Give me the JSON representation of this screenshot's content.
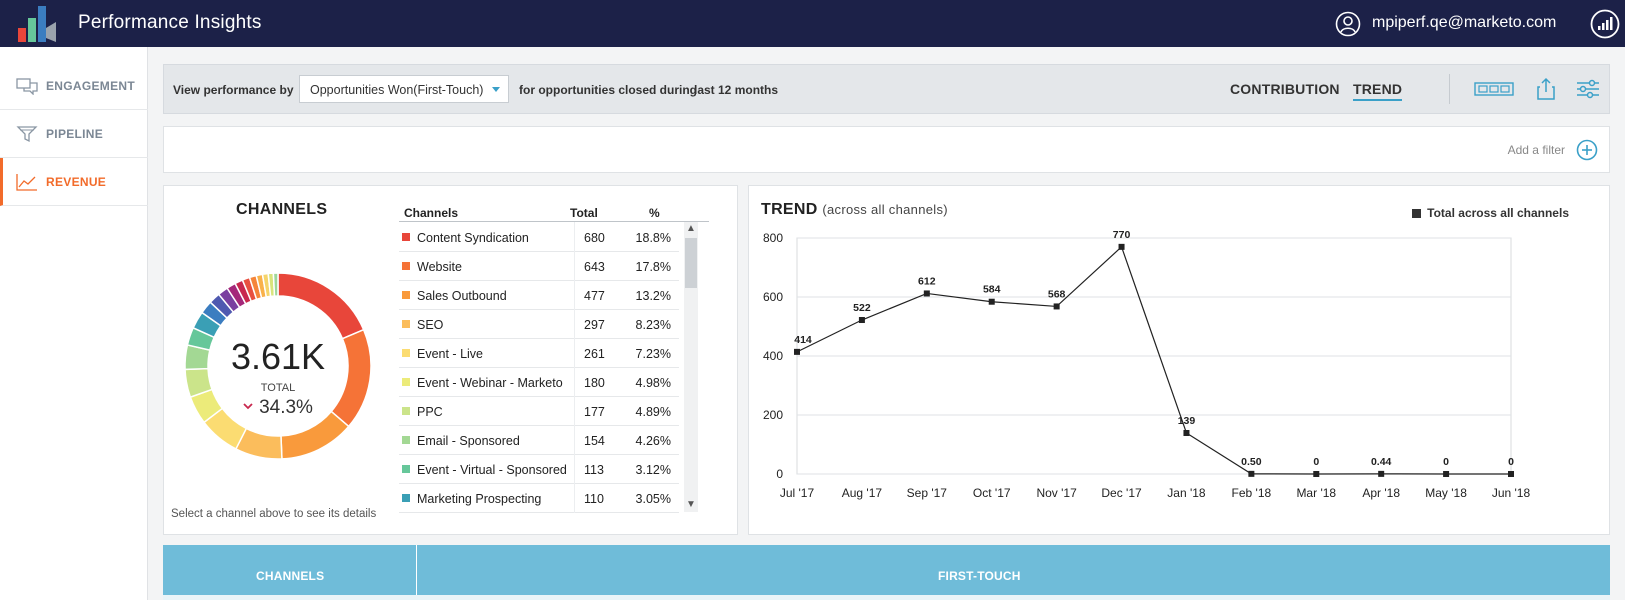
{
  "app": {
    "title": "Performance Insights",
    "user_email": "mpiperf.qe@marketo.com"
  },
  "sidebar": {
    "items": [
      {
        "label": "ENGAGEMENT",
        "icon": "chat-icon",
        "active": false
      },
      {
        "label": "PIPELINE",
        "icon": "funnel-icon",
        "active": false
      },
      {
        "label": "REVENUE",
        "icon": "line-chart-icon",
        "active": true
      }
    ]
  },
  "viewbar": {
    "prefix": "View performance by",
    "selected": "Opportunities Won(First-Touch)",
    "middle": "for opportunities closed during",
    "period": "last 12 months",
    "tabs": [
      {
        "label": "CONTRIBUTION",
        "active": false
      },
      {
        "label": "TREND",
        "active": true
      }
    ]
  },
  "filterbar": {
    "add_filter": "Add a filter"
  },
  "channels": {
    "title": "CHANNELS",
    "total_value": "3.61K",
    "total_label": "TOTAL",
    "change": "34.3%",
    "change_direction": "down",
    "hint": "Select a channel above to see its details",
    "columns": [
      "Channels",
      "Total",
      "%"
    ],
    "rows": [
      {
        "name": "Content Syndication",
        "total": "680",
        "pct": "18.8%",
        "color": "#e8463a"
      },
      {
        "name": "Website",
        "total": "643",
        "pct": "17.8%",
        "color": "#f57337"
      },
      {
        "name": "Sales Outbound",
        "total": "477",
        "pct": "13.2%",
        "color": "#f99a3c"
      },
      {
        "name": "SEO",
        "total": "297",
        "pct": "8.23%",
        "color": "#fbbd5c"
      },
      {
        "name": "Event - Live",
        "total": "261",
        "pct": "7.23%",
        "color": "#fbdc72"
      },
      {
        "name": "Event - Webinar - Marketo",
        "total": "180",
        "pct": "4.98%",
        "color": "#eceb7a"
      },
      {
        "name": "PPC",
        "total": "177",
        "pct": "4.89%",
        "color": "#cbe48a"
      },
      {
        "name": "Email - Sponsored",
        "total": "154",
        "pct": "4.26%",
        "color": "#a3d894"
      },
      {
        "name": "Event - Virtual - Sponsored",
        "total": "113",
        "pct": "3.12%",
        "color": "#66c79a"
      },
      {
        "name": "Marketing Prospecting",
        "total": "110",
        "pct": "3.05%",
        "color": "#3a9fb5"
      }
    ],
    "donut_extra": [
      {
        "pct": 2.3,
        "color": "#3b7dc0"
      },
      {
        "pct": 2.0,
        "color": "#4f59b0"
      },
      {
        "pct": 1.8,
        "color": "#7a3fa0"
      },
      {
        "pct": 1.6,
        "color": "#a4287a"
      },
      {
        "pct": 1.4,
        "color": "#c8284e"
      },
      {
        "pct": 1.3,
        "color": "#e85040"
      },
      {
        "pct": 1.2,
        "color": "#f5853a"
      },
      {
        "pct": 1.1,
        "color": "#f9b14a"
      },
      {
        "pct": 1.0,
        "color": "#f5d46a"
      },
      {
        "pct": 0.9,
        "color": "#d9e47c"
      },
      {
        "pct": 0.8,
        "color": "#9fd69a"
      }
    ]
  },
  "trend": {
    "title": "TREND",
    "subtitle": "(across all channels)",
    "legend": "Total across all channels"
  },
  "chart_data": {
    "type": "line",
    "x": [
      "Jul '17",
      "Aug '17",
      "Sep '17",
      "Oct '17",
      "Nov '17",
      "Dec '17",
      "Jan '18",
      "Feb '18",
      "Mar '18",
      "Apr '18",
      "May '18",
      "Jun '18"
    ],
    "series": [
      {
        "name": "Total across all channels",
        "values": [
          414,
          522,
          612,
          584,
          568,
          770,
          139,
          0.5,
          0,
          0.44,
          0,
          0
        ],
        "labels": [
          "414",
          "522",
          "612",
          "584",
          "568",
          "770",
          "139",
          "0.50",
          "0",
          "0.44",
          "0",
          "0"
        ]
      }
    ],
    "title": "TREND",
    "ylim": [
      0,
      800
    ],
    "yticks": [
      0,
      200,
      400,
      600,
      800
    ],
    "grid": true,
    "legend_position": "top-right"
  },
  "bottom_table": {
    "columns": [
      "CHANNELS",
      "FIRST-TOUCH"
    ]
  },
  "colors": {
    "topbar": "#1c2148",
    "accent_orange": "#f26b2a",
    "accent_blue": "#3aa0c8",
    "table_header": "#6fbcd9"
  }
}
